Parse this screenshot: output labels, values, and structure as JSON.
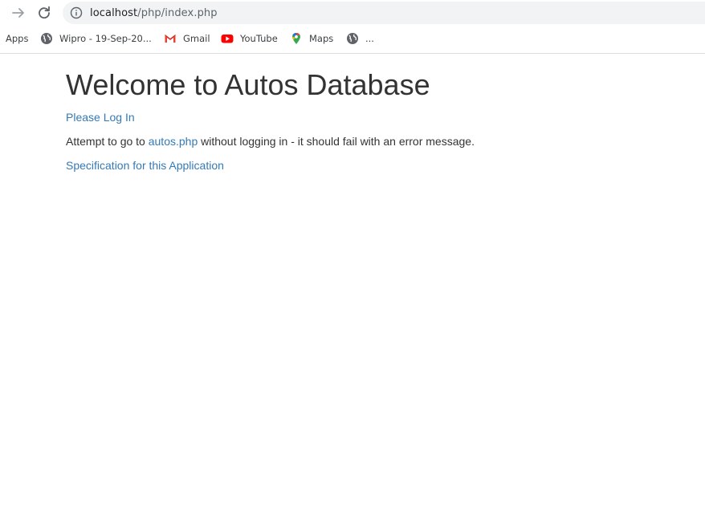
{
  "browser": {
    "url_host": "localhost",
    "url_path": "/php/index.php",
    "icons": {
      "forward": "forward-arrow-icon",
      "reload": "reload-icon",
      "info": "info-icon"
    }
  },
  "bookmarks": {
    "apps": "Apps",
    "wipro": "Wipro - 19-Sep-20...",
    "gmail": "Gmail",
    "youtube": "YouTube",
    "maps": "Maps",
    "more": "..."
  },
  "page": {
    "title": "Welcome to Autos Database",
    "login_link": "Please Log In",
    "attempt_prefix": "Attempt to go to ",
    "attempt_link": "autos.php",
    "attempt_suffix": " without logging in - it should fail with an error message.",
    "spec_link": "Specification for this Application"
  },
  "colors": {
    "link": "#337ab7",
    "text": "#333333",
    "omnibox_bg": "#f1f3f4"
  }
}
